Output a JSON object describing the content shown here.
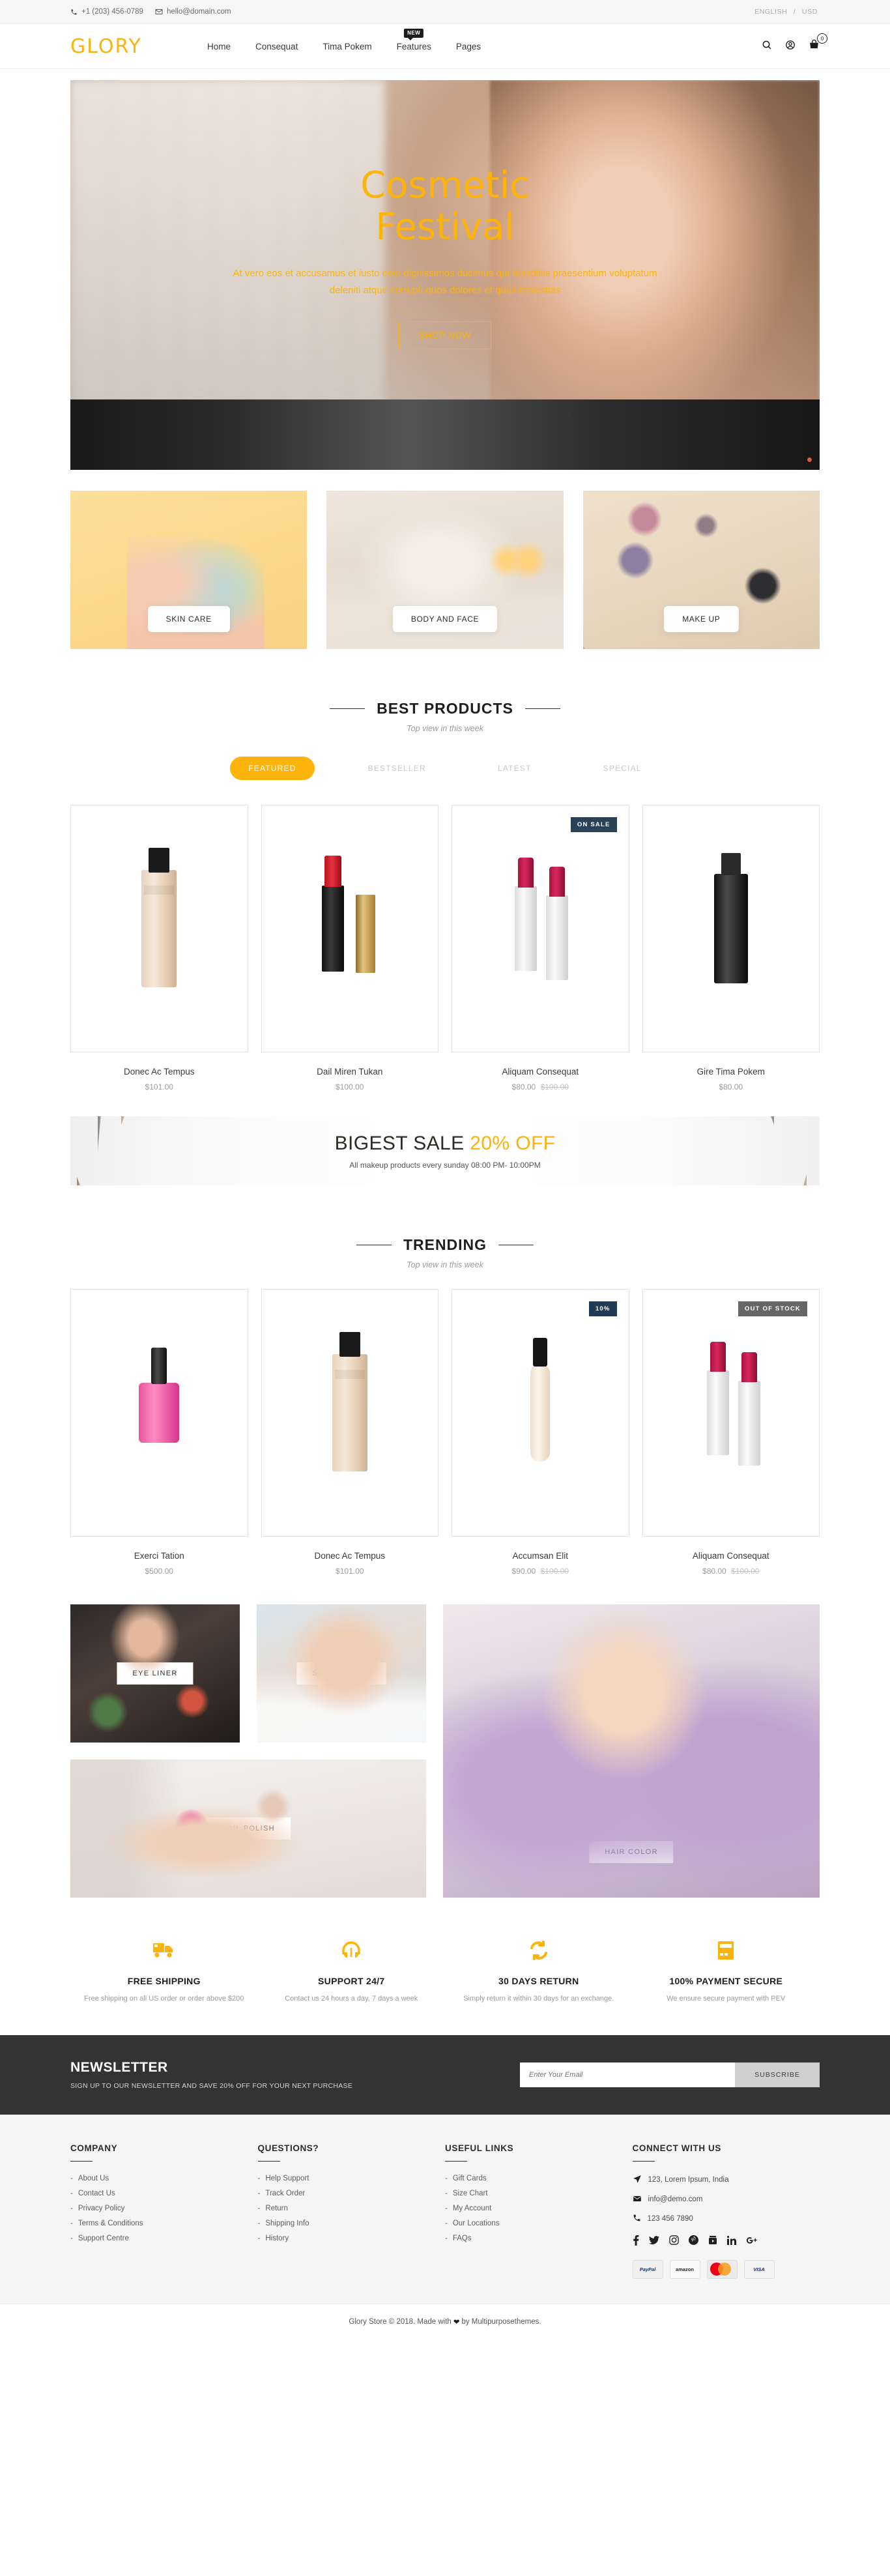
{
  "topbar": {
    "phone": "+1 (203) 456-0789",
    "email": "hello@domain.com",
    "language": "ENGLISH",
    "separator": "/",
    "currency": "USD"
  },
  "header": {
    "logo": "GLORY",
    "nav": [
      {
        "label": "Home",
        "badge": null
      },
      {
        "label": "Consequat",
        "badge": null
      },
      {
        "label": "Tima Pokem",
        "badge": null
      },
      {
        "label": "Features",
        "badge": "NEW"
      },
      {
        "label": "Pages",
        "badge": null
      }
    ],
    "cart_count": "0"
  },
  "hero": {
    "title_line1": "Cosmetic",
    "title_line2": "Festival",
    "description": "At vero eos et accusamus et iusto odio dignissimos ducimus qui blanditiis praesentium voluptatum deleniti atque corrupti quos dolores et quas molestias",
    "button": "SHOP NOW"
  },
  "categories": [
    {
      "label": "SKIN CARE"
    },
    {
      "label": "BODY AND FACE"
    },
    {
      "label": "MAKE UP"
    }
  ],
  "best_products": {
    "title": "BEST PRODUCTS",
    "subtitle": "Top view in this week",
    "tabs": [
      {
        "label": "FEATURED",
        "active": true
      },
      {
        "label": "BESTSELLER",
        "active": false
      },
      {
        "label": "LATEST",
        "active": false
      },
      {
        "label": "SPECIAL",
        "active": false
      }
    ],
    "items": [
      {
        "name": "Donec Ac Tempus",
        "price": "$101.00",
        "old_price": "",
        "badge": "",
        "badge_type": ""
      },
      {
        "name": "Dail Miren Tukan",
        "price": "$100.00",
        "old_price": "",
        "badge": "",
        "badge_type": ""
      },
      {
        "name": "Aliquam Consequat",
        "price": "$80.00",
        "old_price": "$100.00",
        "badge": "ON SALE",
        "badge_type": "sale"
      },
      {
        "name": "Gire Tima Pokem",
        "price": "$80.00",
        "old_price": "",
        "badge": "",
        "badge_type": ""
      }
    ]
  },
  "sale_banner": {
    "headline_main": "BIGEST SALE ",
    "headline_accent": "20% OFF",
    "subtext": "All makeup products every sunday 08:00 PM- 10:00PM"
  },
  "trending": {
    "title": "TRENDING",
    "subtitle": "Top view in this week",
    "items": [
      {
        "name": "Exerci Tation",
        "price": "$500.00",
        "old_price": "",
        "badge": "",
        "badge_type": ""
      },
      {
        "name": "Donec Ac Tempus",
        "price": "$101.00",
        "old_price": "",
        "badge": "",
        "badge_type": ""
      },
      {
        "name": "Accumsan Elit",
        "price": "$90.00",
        "old_price": "$100.00",
        "badge": "10%",
        "badge_type": "pct"
      },
      {
        "name": "Aliquam Consequat",
        "price": "$80.00",
        "old_price": "$100.00",
        "badge": "OUT OF STOCK",
        "badge_type": "oos"
      }
    ]
  },
  "lookbook": [
    {
      "label": "EYE LINER"
    },
    {
      "label": "SKIN TONNER"
    },
    {
      "label": "NAIL POLISH"
    },
    {
      "label": "HAIR COLOR"
    }
  ],
  "services": [
    {
      "icon": "truck-icon",
      "title": "FREE SHIPPING",
      "desc": "Free shipping on all US order or order above $200"
    },
    {
      "icon": "headphones-icon",
      "title": "SUPPORT 24/7",
      "desc": "Contact us 24 hours a day, 7 days a week"
    },
    {
      "icon": "refresh-icon",
      "title": "30 DAYS RETURN",
      "desc": "Simply return it within 30 days for an exchange."
    },
    {
      "icon": "credit-card-icon",
      "title": "100% PAYMENT SECURE",
      "desc": "We ensure secure payment with PEV"
    }
  ],
  "newsletter": {
    "title": "NEWSLETTER",
    "subtitle": "SIGN UP TO OUR NEWSLETTER AND SAVE 20% OFF FOR YOUR NEXT PURCHASE",
    "input_placeholder": "Enter Your Email",
    "button": "SUBSCRIBE"
  },
  "footer": {
    "columns": [
      {
        "title": "COMPANY",
        "links": [
          "About Us",
          "Contact Us",
          "Privacy Policy",
          "Terms & Conditions",
          "Support Centre"
        ]
      },
      {
        "title": "QUESTIONS?",
        "links": [
          "Help Support",
          "Track Order",
          "Return",
          "Shipping Info",
          "History"
        ]
      },
      {
        "title": "USEFUL LINKS",
        "links": [
          "Gift Cards",
          "Size Chart",
          "My Account",
          "Our Locations",
          "FAQs"
        ]
      }
    ],
    "connect": {
      "title": "CONNECT WITH US",
      "address": "123, Lorem Ipsum, India",
      "email": "info@demo.com",
      "phone": "123 456 7890",
      "socials": [
        "facebook-icon",
        "twitter-icon",
        "instagram-icon",
        "pinterest-icon",
        "youtube-icon",
        "linkedin-icon",
        "googleplus-icon"
      ],
      "payments": [
        "PayPal",
        "amazon",
        "MasterCard",
        "VISA"
      ]
    }
  },
  "copyright": {
    "prefix": "Glory Store © 2018. Made with",
    "suffix": "by Multipurposethemes."
  }
}
